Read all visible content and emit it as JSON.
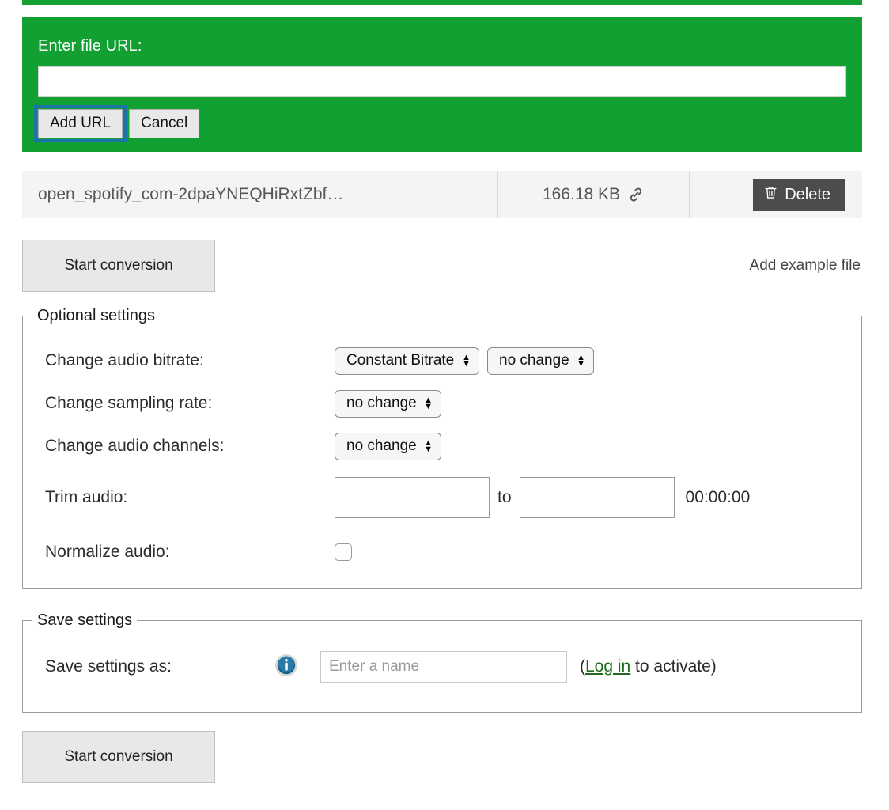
{
  "url_panel": {
    "label": "Enter file URL:",
    "input_value": "",
    "input_placeholder": "",
    "add_button": "Add URL",
    "cancel_button": "Cancel",
    "background_color": "#12a033",
    "focus_ring_color": "#1b74a8"
  },
  "file_row": {
    "name": "open_spotify_com-2dpaYNEQHiRxtZbf…",
    "size": "166.18 KB",
    "source_icon": "link-icon",
    "delete_label": "Delete",
    "delete_icon": "trash-icon",
    "delete_color": "#4c4c4c"
  },
  "actions": {
    "start_conversion_top": "Start conversion",
    "start_conversion_bottom": "Start conversion",
    "add_example_file": "Add example file"
  },
  "optional_settings": {
    "legend": "Optional settings",
    "rows": [
      {
        "label": "Change audio bitrate:",
        "selects": [
          {
            "value": "Constant Bitrate",
            "name": "bitrate-mode-select"
          },
          {
            "value": "no change",
            "name": "bitrate-value-select"
          }
        ]
      },
      {
        "label": "Change sampling rate:",
        "selects": [
          {
            "value": "no change",
            "name": "sampling-rate-select"
          }
        ]
      },
      {
        "label": "Change audio channels:",
        "selects": [
          {
            "value": "no change",
            "name": "audio-channels-select"
          }
        ]
      }
    ],
    "trim": {
      "label": "Trim audio:",
      "from_value": "",
      "to_separator": "to",
      "to_value": "",
      "duration": "00:00:00"
    },
    "normalize": {
      "label": "Normalize audio:",
      "checked": false
    }
  },
  "save_settings": {
    "legend": "Save settings",
    "label": "Save settings as:",
    "info_icon": "info-icon",
    "name_value": "",
    "name_placeholder": "Enter a name",
    "prefix": "(",
    "login_link": "Log in",
    "suffix": " to activate)",
    "link_color": "#1d6b1d"
  }
}
